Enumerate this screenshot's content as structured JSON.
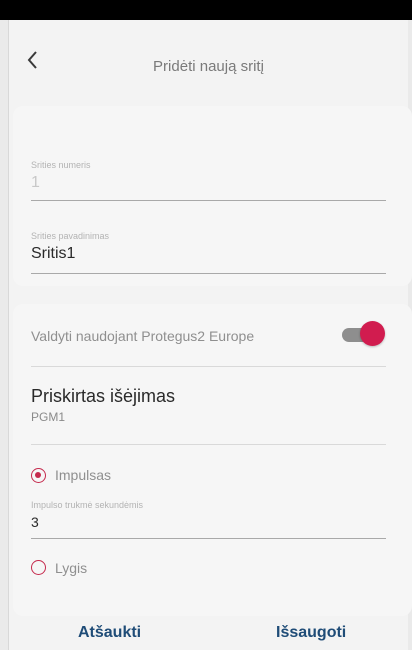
{
  "header": {
    "title": "Pridėti naują sritį",
    "back_icon": "chevron-left-icon"
  },
  "area_number": {
    "label": "Srities numeris",
    "value": "1"
  },
  "area_name": {
    "label": "Srities pavadinimas",
    "value": "Sritis1"
  },
  "control": {
    "label": "Valdyti naudojant Protegus2 Europe",
    "enabled": true,
    "color": "#d11c4f"
  },
  "output": {
    "title": "Priskirtas išėjimas",
    "value": "PGM1"
  },
  "mode": {
    "impulse_label": "Impulsas",
    "impulse_selected": true,
    "duration": {
      "label": "Impulso trukmė sekundėmis",
      "value": "3"
    },
    "level_label": "Lygis",
    "level_selected": false
  },
  "footer": {
    "cancel_label": "Atšaukti",
    "save_label": "Išsaugoti"
  }
}
